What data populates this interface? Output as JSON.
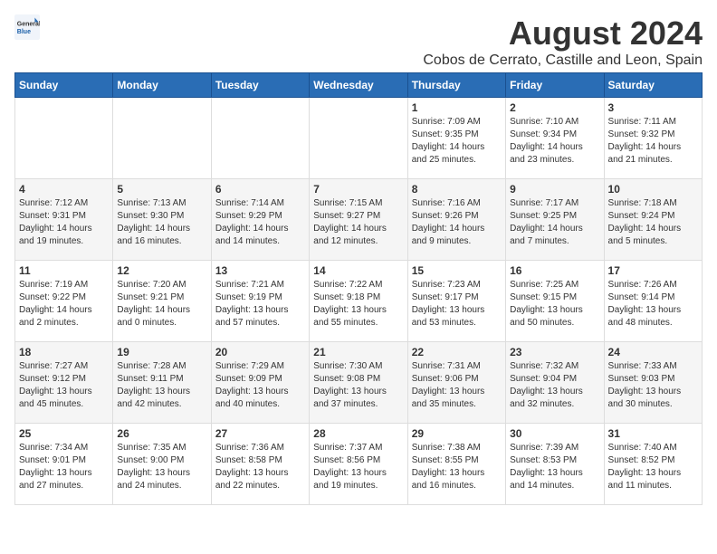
{
  "logo": {
    "general": "General",
    "blue": "Blue"
  },
  "header": {
    "title": "August 2024",
    "subtitle": "Cobos de Cerrato, Castille and Leon, Spain"
  },
  "weekdays": [
    "Sunday",
    "Monday",
    "Tuesday",
    "Wednesday",
    "Thursday",
    "Friday",
    "Saturday"
  ],
  "weeks": [
    [
      {
        "day": "",
        "content": ""
      },
      {
        "day": "",
        "content": ""
      },
      {
        "day": "",
        "content": ""
      },
      {
        "day": "",
        "content": ""
      },
      {
        "day": "1",
        "content": "Sunrise: 7:09 AM\nSunset: 9:35 PM\nDaylight: 14 hours\nand 25 minutes."
      },
      {
        "day": "2",
        "content": "Sunrise: 7:10 AM\nSunset: 9:34 PM\nDaylight: 14 hours\nand 23 minutes."
      },
      {
        "day": "3",
        "content": "Sunrise: 7:11 AM\nSunset: 9:32 PM\nDaylight: 14 hours\nand 21 minutes."
      }
    ],
    [
      {
        "day": "4",
        "content": "Sunrise: 7:12 AM\nSunset: 9:31 PM\nDaylight: 14 hours\nand 19 minutes."
      },
      {
        "day": "5",
        "content": "Sunrise: 7:13 AM\nSunset: 9:30 PM\nDaylight: 14 hours\nand 16 minutes."
      },
      {
        "day": "6",
        "content": "Sunrise: 7:14 AM\nSunset: 9:29 PM\nDaylight: 14 hours\nand 14 minutes."
      },
      {
        "day": "7",
        "content": "Sunrise: 7:15 AM\nSunset: 9:27 PM\nDaylight: 14 hours\nand 12 minutes."
      },
      {
        "day": "8",
        "content": "Sunrise: 7:16 AM\nSunset: 9:26 PM\nDaylight: 14 hours\nand 9 minutes."
      },
      {
        "day": "9",
        "content": "Sunrise: 7:17 AM\nSunset: 9:25 PM\nDaylight: 14 hours\nand 7 minutes."
      },
      {
        "day": "10",
        "content": "Sunrise: 7:18 AM\nSunset: 9:24 PM\nDaylight: 14 hours\nand 5 minutes."
      }
    ],
    [
      {
        "day": "11",
        "content": "Sunrise: 7:19 AM\nSunset: 9:22 PM\nDaylight: 14 hours\nand 2 minutes."
      },
      {
        "day": "12",
        "content": "Sunrise: 7:20 AM\nSunset: 9:21 PM\nDaylight: 14 hours\nand 0 minutes."
      },
      {
        "day": "13",
        "content": "Sunrise: 7:21 AM\nSunset: 9:19 PM\nDaylight: 13 hours\nand 57 minutes."
      },
      {
        "day": "14",
        "content": "Sunrise: 7:22 AM\nSunset: 9:18 PM\nDaylight: 13 hours\nand 55 minutes."
      },
      {
        "day": "15",
        "content": "Sunrise: 7:23 AM\nSunset: 9:17 PM\nDaylight: 13 hours\nand 53 minutes."
      },
      {
        "day": "16",
        "content": "Sunrise: 7:25 AM\nSunset: 9:15 PM\nDaylight: 13 hours\nand 50 minutes."
      },
      {
        "day": "17",
        "content": "Sunrise: 7:26 AM\nSunset: 9:14 PM\nDaylight: 13 hours\nand 48 minutes."
      }
    ],
    [
      {
        "day": "18",
        "content": "Sunrise: 7:27 AM\nSunset: 9:12 PM\nDaylight: 13 hours\nand 45 minutes."
      },
      {
        "day": "19",
        "content": "Sunrise: 7:28 AM\nSunset: 9:11 PM\nDaylight: 13 hours\nand 42 minutes."
      },
      {
        "day": "20",
        "content": "Sunrise: 7:29 AM\nSunset: 9:09 PM\nDaylight: 13 hours\nand 40 minutes."
      },
      {
        "day": "21",
        "content": "Sunrise: 7:30 AM\nSunset: 9:08 PM\nDaylight: 13 hours\nand 37 minutes."
      },
      {
        "day": "22",
        "content": "Sunrise: 7:31 AM\nSunset: 9:06 PM\nDaylight: 13 hours\nand 35 minutes."
      },
      {
        "day": "23",
        "content": "Sunrise: 7:32 AM\nSunset: 9:04 PM\nDaylight: 13 hours\nand 32 minutes."
      },
      {
        "day": "24",
        "content": "Sunrise: 7:33 AM\nSunset: 9:03 PM\nDaylight: 13 hours\nand 30 minutes."
      }
    ],
    [
      {
        "day": "25",
        "content": "Sunrise: 7:34 AM\nSunset: 9:01 PM\nDaylight: 13 hours\nand 27 minutes."
      },
      {
        "day": "26",
        "content": "Sunrise: 7:35 AM\nSunset: 9:00 PM\nDaylight: 13 hours\nand 24 minutes."
      },
      {
        "day": "27",
        "content": "Sunrise: 7:36 AM\nSunset: 8:58 PM\nDaylight: 13 hours\nand 22 minutes."
      },
      {
        "day": "28",
        "content": "Sunrise: 7:37 AM\nSunset: 8:56 PM\nDaylight: 13 hours\nand 19 minutes."
      },
      {
        "day": "29",
        "content": "Sunrise: 7:38 AM\nSunset: 8:55 PM\nDaylight: 13 hours\nand 16 minutes."
      },
      {
        "day": "30",
        "content": "Sunrise: 7:39 AM\nSunset: 8:53 PM\nDaylight: 13 hours\nand 14 minutes."
      },
      {
        "day": "31",
        "content": "Sunrise: 7:40 AM\nSunset: 8:52 PM\nDaylight: 13 hours\nand 11 minutes."
      }
    ]
  ]
}
